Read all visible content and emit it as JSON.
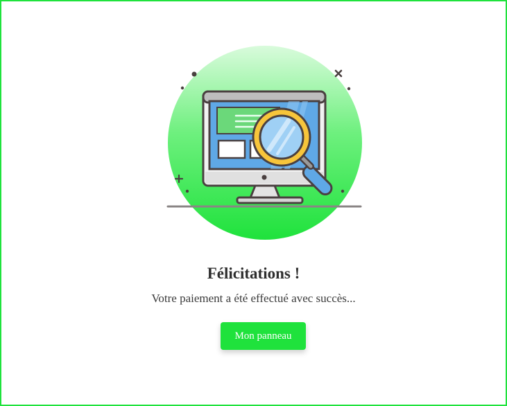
{
  "colors": {
    "accent": "#1fe23c",
    "frame_border": "#1fe23c",
    "title_text": "#2e2e2e",
    "body_text": "#3a3a3a",
    "button_text": "#ffffff"
  },
  "illustration": {
    "icon": "monitor-magnifier-icon"
  },
  "success": {
    "title": "Félicitations !",
    "message": "Votre paiement a été effectué avec succès..."
  },
  "actions": {
    "dashboard_label": "Mon panneau"
  }
}
